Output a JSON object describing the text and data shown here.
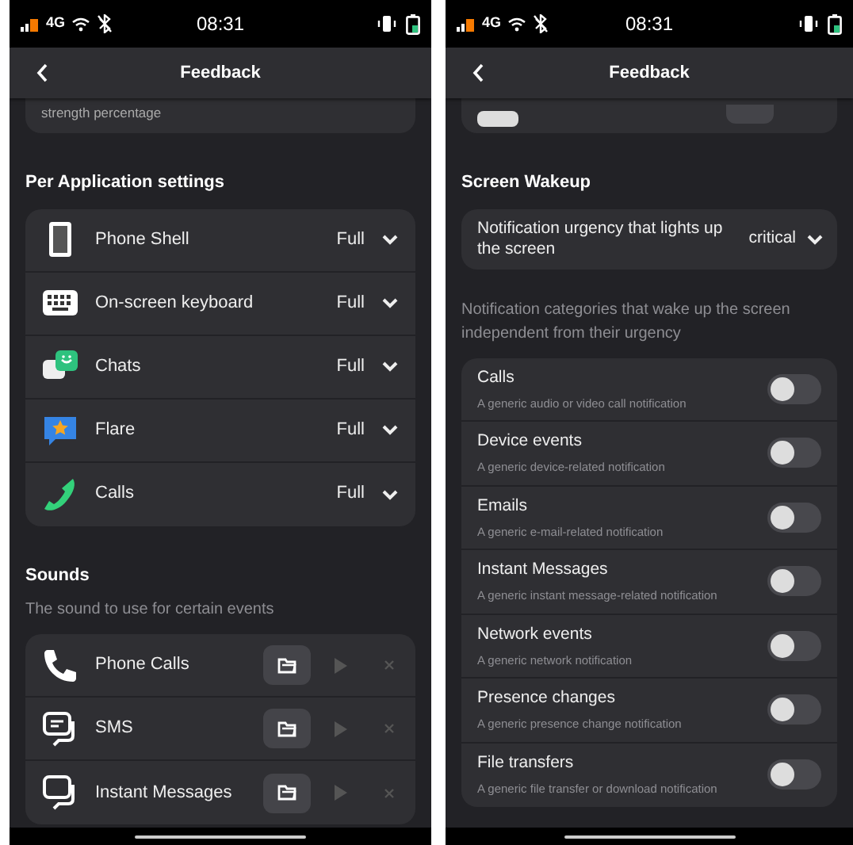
{
  "screens": [
    {
      "status_bar": {
        "network": "4G",
        "time": "08:31"
      },
      "header": {
        "title": "Feedback"
      },
      "sections": [
        {
          "kind": "cut_card",
          "text": "strength percentage"
        },
        {
          "kind": "heading",
          "title": "Per Application settings"
        },
        {
          "kind": "app_list",
          "rows": [
            {
              "name": "Phone Shell",
              "value": "Full"
            },
            {
              "name": "On-screen keyboard",
              "value": "Full"
            },
            {
              "name": "Chats",
              "value": "Full"
            },
            {
              "name": "Flare",
              "value": "Full"
            },
            {
              "name": "Calls",
              "value": "Full"
            }
          ]
        },
        {
          "kind": "heading",
          "title": "Sounds",
          "subtitle": "The sound to use for certain events"
        },
        {
          "kind": "sound_list",
          "rows": [
            {
              "name": "Phone Calls"
            },
            {
              "name": "SMS"
            },
            {
              "name": "Instant Messages"
            }
          ]
        }
      ]
    },
    {
      "status_bar": {
        "network": "4G",
        "time": "08:31"
      },
      "header": {
        "title": "Feedback"
      },
      "sections": [
        {
          "kind": "cut_card"
        },
        {
          "kind": "heading",
          "title": "Screen Wakeup"
        },
        {
          "kind": "combo",
          "label": "Notification urgency that lights up the screen",
          "value": "critical"
        },
        {
          "kind": "heading",
          "subtitle": "Notification categories that wake up the screen independent from their urgency"
        },
        {
          "kind": "switch_list",
          "rows": [
            {
              "title": "Calls",
              "subtitle": "A generic audio or video call notification",
              "on": false
            },
            {
              "title": "Device events",
              "subtitle": "A generic device-related notification",
              "on": false
            },
            {
              "title": "Emails",
              "subtitle": "A generic e-mail-related notification",
              "on": false
            },
            {
              "title": "Instant Messages",
              "subtitle": "A generic instant message-related notification",
              "on": false
            },
            {
              "title": "Network events",
              "subtitle": "A generic network notification",
              "on": false
            },
            {
              "title": "Presence changes",
              "subtitle": "A generic presence change notification",
              "on": false
            },
            {
              "title": "File transfers",
              "subtitle": "A generic file transfer or download notification",
              "on": false
            }
          ]
        }
      ]
    }
  ]
}
